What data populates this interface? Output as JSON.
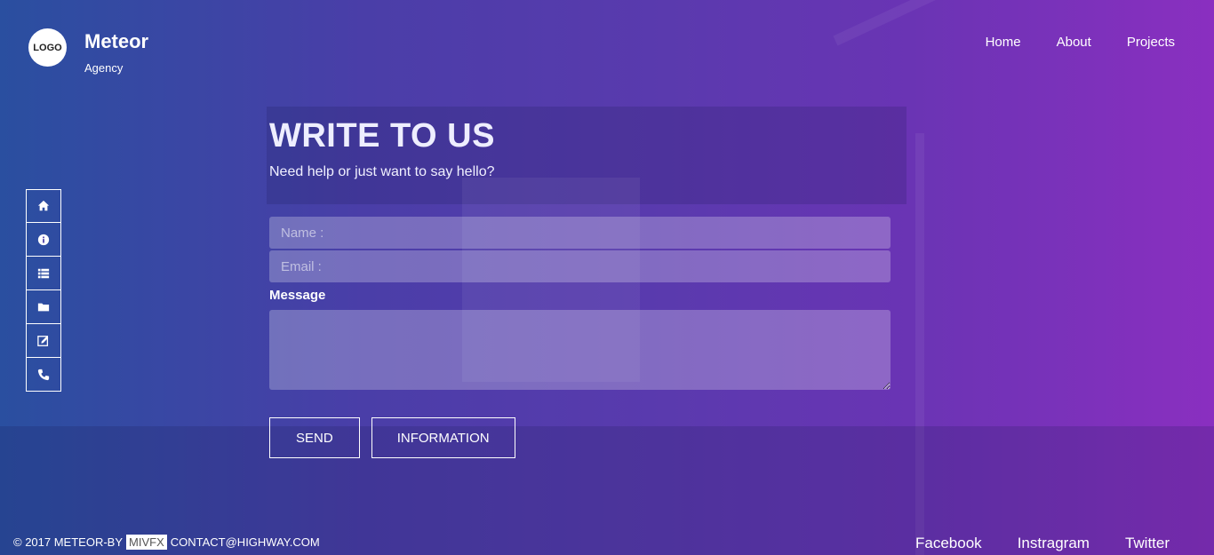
{
  "header": {
    "logo_text": "LOGO",
    "brand_name": "Meteor",
    "brand_sub": "Agency"
  },
  "nav": {
    "items": [
      {
        "label": "Home"
      },
      {
        "label": "About"
      },
      {
        "label": "Projects"
      }
    ]
  },
  "sidenav": {
    "icons": [
      "home-icon",
      "info-icon",
      "list-icon",
      "folder-icon",
      "edit-icon",
      "phone-icon"
    ]
  },
  "contact": {
    "title": "WRITE TO US",
    "subtitle": "Need help or just want to say hello?",
    "name_placeholder": "Name :",
    "email_placeholder": "Email :",
    "message_label": "Message",
    "send_label": "SEND",
    "info_label": "INFORMATION"
  },
  "footer": {
    "copyright": "© 2017 METEOR-BY",
    "author_tag": "MIVFX",
    "contact": "CONTACT@HIGHWAY.COM",
    "social": [
      {
        "label": "Facebook"
      },
      {
        "label": "Instragram"
      },
      {
        "label": "Twitter"
      }
    ]
  },
  "colors": {
    "gradient_start": "#2a4fa0",
    "gradient_end": "#8a2fc0"
  }
}
